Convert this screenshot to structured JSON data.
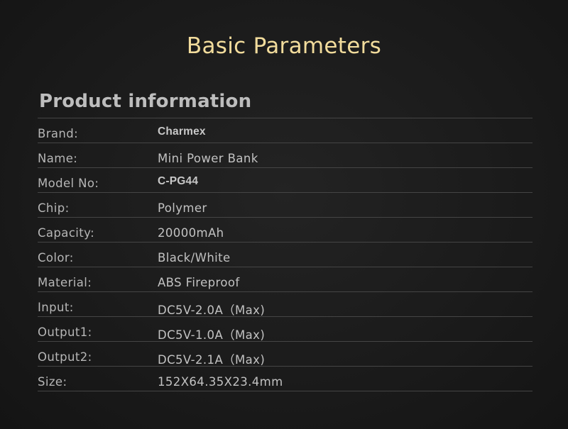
{
  "header": {
    "title": "Basic Parameters"
  },
  "section": {
    "title": "Product information"
  },
  "rows": [
    {
      "label": "Brand:",
      "value": "Charmex"
    },
    {
      "label": "Name:",
      "value": "Mini Power Bank"
    },
    {
      "label": "Model No:",
      "value": "C-PG44"
    },
    {
      "label": "Chip:",
      "value": "Polymer"
    },
    {
      "label": "Capacity:",
      "value": "20000mAh"
    },
    {
      "label": "Color:",
      "value": "Black/White"
    },
    {
      "label": "Material:",
      "value": "ABS Fireproof"
    },
    {
      "label": "Input:",
      "value": "DC5V-2.0A（Max)"
    },
    {
      "label": "Output1:",
      "value": "DC5V-1.0A（Max)"
    },
    {
      "label": "Output2:",
      "value": "DC5V-2.1A（Max)"
    },
    {
      "label": "Size:",
      "value": "152X64.35X23.4mm"
    }
  ],
  "colors": {
    "title": "#f2dc9c",
    "background": "#1b1b1b",
    "divider": "#454545",
    "text": "#b6b6b6"
  }
}
